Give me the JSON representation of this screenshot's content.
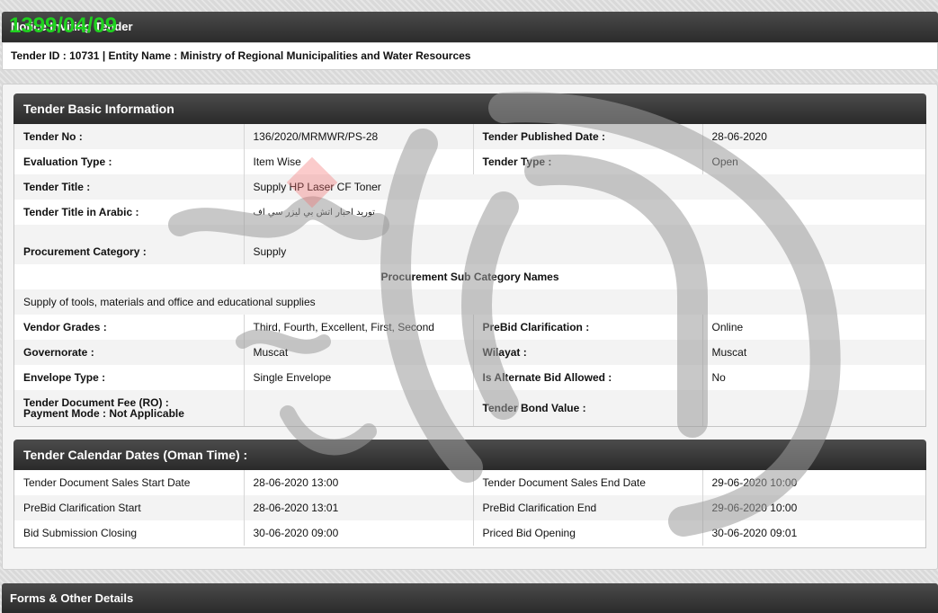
{
  "header": {
    "title": "Notice Inviting Tender",
    "stamp": "1399/04/09"
  },
  "tender_id_line": "Tender ID : 10731 | Entity Name : Ministry of Regional Municipalities and Water Resources",
  "basic": {
    "title": "Tender Basic Information",
    "tender_no_label": "Tender No :",
    "tender_no": "136/2020/MRMWR/PS-28",
    "published_label": "Tender Published Date :",
    "published": "28-06-2020",
    "eval_label": "Evaluation Type :",
    "eval": "Item Wise",
    "type_label": "Tender Type :",
    "type": "Open",
    "title_label": "Tender Title :",
    "tender_title": "Supply HP Laser CF Toner",
    "arabic_label": "Tender Title in Arabic :",
    "arabic": "توريد احبار اتش بي ليزر سي اف",
    "proc_label": "Procurement Category :",
    "proc": "Supply",
    "subcat_heading": "Procurement Sub Category Names",
    "subcat": "Supply of tools, materials and office and educational supplies",
    "vendor_label": "Vendor Grades :",
    "vendor": "Third, Fourth, Excellent, First, Second",
    "prebid_label": "PreBid Clarification :",
    "prebid": "Online",
    "gov_label": "Governorate :",
    "gov": "Muscat",
    "wilayat_label": "Wilayat :",
    "wilayat": "Muscat",
    "env_label": "Envelope Type :",
    "env": "Single Envelope",
    "alt_label": "Is Alternate Bid Allowed :",
    "alt": "No",
    "fee_label": "Tender Document Fee (RO) :",
    "payment_label": "Payment Mode :  Not Applicable",
    "bond_label": "Tender Bond Value :"
  },
  "calendar": {
    "title": "Tender Calendar Dates (Oman Time) :",
    "rows": [
      {
        "l1": "Tender Document Sales Start Date",
        "v1": "28-06-2020 13:00",
        "l2": "Tender Document Sales End Date",
        "v2": "29-06-2020 10:00"
      },
      {
        "l1": "PreBid Clarification Start",
        "v1": "28-06-2020 13:01",
        "l2": "PreBid Clarification End",
        "v2": "29-06-2020 10:00"
      },
      {
        "l1": "Bid Submission Closing",
        "v1": "30-06-2020 09:00",
        "l2": "Priced Bid Opening",
        "v2": "30-06-2020 09:01"
      }
    ]
  },
  "footer": {
    "title": "Forms & Other Details"
  },
  "watermark": {
    "color": "#9a9a9a",
    "accent": "#f36b6b"
  }
}
